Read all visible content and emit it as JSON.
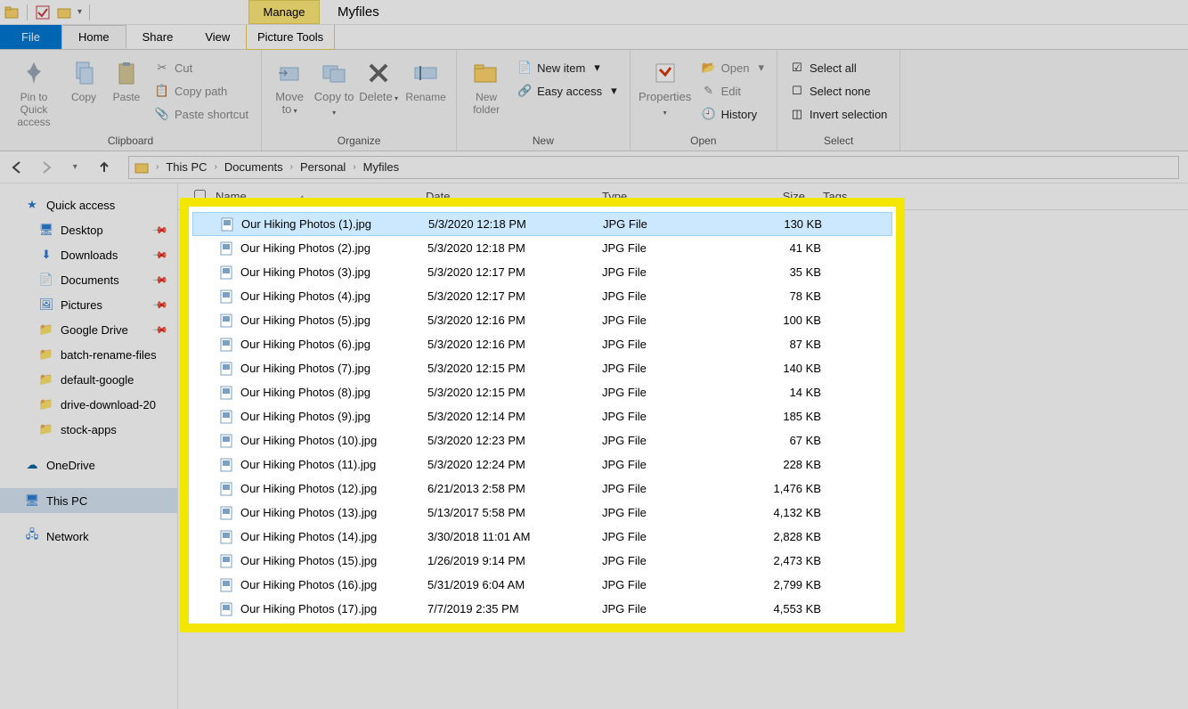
{
  "title": "Myfiles",
  "tabs": {
    "file": "File",
    "home": "Home",
    "share": "Share",
    "view": "View",
    "manage": "Manage",
    "picture_tools": "Picture Tools"
  },
  "ribbon": {
    "clipboard": {
      "label": "Clipboard",
      "pin": "Pin to Quick access",
      "copy": "Copy",
      "paste": "Paste",
      "cut": "Cut",
      "copypath": "Copy path",
      "pasteshortcut": "Paste shortcut"
    },
    "organize": {
      "label": "Organize",
      "moveto": "Move to",
      "copyto": "Copy to",
      "delete": "Delete",
      "rename": "Rename"
    },
    "new": {
      "label": "New",
      "newfolder": "New folder",
      "newitem": "New item",
      "easyaccess": "Easy access"
    },
    "open": {
      "label": "Open",
      "properties": "Properties",
      "open": "Open",
      "edit": "Edit",
      "history": "History"
    },
    "select": {
      "label": "Select",
      "selectall": "Select all",
      "selectnone": "Select none",
      "invert": "Invert selection"
    }
  },
  "breadcrumb": [
    "This PC",
    "Documents",
    "Personal",
    "Myfiles"
  ],
  "sidebar": {
    "quick": "Quick access",
    "items": [
      {
        "label": "Desktop",
        "pin": true
      },
      {
        "label": "Downloads",
        "pin": true
      },
      {
        "label": "Documents",
        "pin": true
      },
      {
        "label": "Pictures",
        "pin": true
      },
      {
        "label": "Google Drive",
        "pin": true
      },
      {
        "label": "batch-rename-files",
        "pin": false
      },
      {
        "label": "default-google",
        "pin": false
      },
      {
        "label": "drive-download-20",
        "pin": false
      },
      {
        "label": "stock-apps",
        "pin": false
      }
    ],
    "onedrive": "OneDrive",
    "thispc": "This PC",
    "network": "Network"
  },
  "columns": {
    "name": "Name",
    "date": "Date",
    "type": "Type",
    "size": "Size",
    "tags": "Tags"
  },
  "files": [
    {
      "name": "Our Hiking Photos (1).jpg",
      "date": "5/3/2020 12:18 PM",
      "type": "JPG File",
      "size": "130 KB"
    },
    {
      "name": "Our Hiking Photos (2).jpg",
      "date": "5/3/2020 12:18 PM",
      "type": "JPG File",
      "size": "41 KB"
    },
    {
      "name": "Our Hiking Photos (3).jpg",
      "date": "5/3/2020 12:17 PM",
      "type": "JPG File",
      "size": "35 KB"
    },
    {
      "name": "Our Hiking Photos (4).jpg",
      "date": "5/3/2020 12:17 PM",
      "type": "JPG File",
      "size": "78 KB"
    },
    {
      "name": "Our Hiking Photos (5).jpg",
      "date": "5/3/2020 12:16 PM",
      "type": "JPG File",
      "size": "100 KB"
    },
    {
      "name": "Our Hiking Photos (6).jpg",
      "date": "5/3/2020 12:16 PM",
      "type": "JPG File",
      "size": "87 KB"
    },
    {
      "name": "Our Hiking Photos (7).jpg",
      "date": "5/3/2020 12:15 PM",
      "type": "JPG File",
      "size": "140 KB"
    },
    {
      "name": "Our Hiking Photos (8).jpg",
      "date": "5/3/2020 12:15 PM",
      "type": "JPG File",
      "size": "14 KB"
    },
    {
      "name": "Our Hiking Photos (9).jpg",
      "date": "5/3/2020 12:14 PM",
      "type": "JPG File",
      "size": "185 KB"
    },
    {
      "name": "Our Hiking Photos (10).jpg",
      "date": "5/3/2020 12:23 PM",
      "type": "JPG File",
      "size": "67 KB"
    },
    {
      "name": "Our Hiking Photos (11).jpg",
      "date": "5/3/2020 12:24 PM",
      "type": "JPG File",
      "size": "228 KB"
    },
    {
      "name": "Our Hiking Photos (12).jpg",
      "date": "6/21/2013 2:58 PM",
      "type": "JPG File",
      "size": "1,476 KB"
    },
    {
      "name": "Our Hiking Photos (13).jpg",
      "date": "5/13/2017 5:58 PM",
      "type": "JPG File",
      "size": "4,132 KB"
    },
    {
      "name": "Our Hiking Photos (14).jpg",
      "date": "3/30/2018 11:01 AM",
      "type": "JPG File",
      "size": "2,828 KB"
    },
    {
      "name": "Our Hiking Photos (15).jpg",
      "date": "1/26/2019 9:14 PM",
      "type": "JPG File",
      "size": "2,473 KB"
    },
    {
      "name": "Our Hiking Photos (16).jpg",
      "date": "5/31/2019 6:04 AM",
      "type": "JPG File",
      "size": "2,799 KB"
    },
    {
      "name": "Our Hiking Photos (17).jpg",
      "date": "7/7/2019 2:35 PM",
      "type": "JPG File",
      "size": "4,553 KB"
    }
  ]
}
